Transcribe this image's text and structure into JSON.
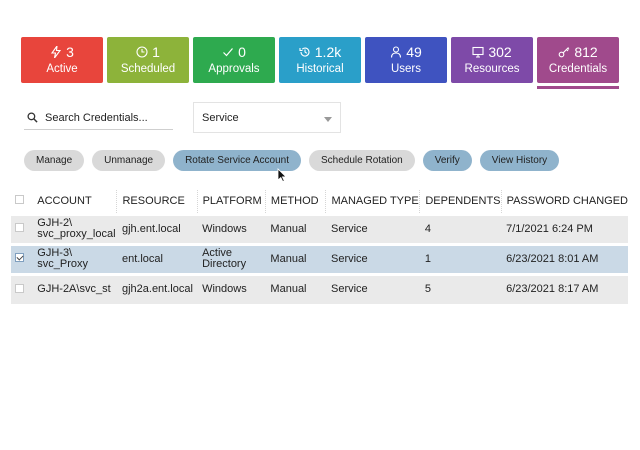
{
  "colors": {
    "active": "#e8453c",
    "scheduled": "#8db33a",
    "approvals": "#2eaa4f",
    "historical": "#2a9fc9",
    "users": "#3f53c0",
    "resources": "#7e4aa8",
    "credentials": "#a04a8c",
    "action_gray": "#d9d9d9",
    "action_blue": "#8fb3cc",
    "row_selected": "#cad9e6"
  },
  "tiles": [
    {
      "icon": "lightning-icon",
      "count": "3",
      "label": "Active"
    },
    {
      "icon": "clock-icon",
      "count": "1",
      "label": "Scheduled"
    },
    {
      "icon": "check-icon",
      "count": "0",
      "label": "Approvals"
    },
    {
      "icon": "history-icon",
      "count": "1.2k",
      "label": "Historical"
    },
    {
      "icon": "user-icon",
      "count": "49",
      "label": "Users"
    },
    {
      "icon": "monitor-icon",
      "count": "302",
      "label": "Resources"
    },
    {
      "icon": "key-icon",
      "count": "812",
      "label": "Credentials"
    }
  ],
  "search": {
    "placeholder": "Search Credentials..."
  },
  "filter": {
    "selected": "Service"
  },
  "actions": [
    "Manage",
    "Unmanage",
    "Rotate Service Account",
    "Schedule Rotation",
    "Verify",
    "View History"
  ],
  "table": {
    "headers": [
      "ACCOUNT",
      "RESOURCE",
      "PLATFORM",
      "METHOD",
      "MANAGED TYPE",
      "DEPENDENTS",
      "PASSWORD CHANGED"
    ],
    "rows": [
      {
        "account": "GJH-2\\ svc_proxy_local",
        "resource": "gjh.ent.local",
        "platform": "Windows",
        "method": "Manual",
        "type": "Service",
        "dependents": "4",
        "changed": "7/1/2021 6:24 PM"
      },
      {
        "account": "GJH-3\\ svc_Proxy",
        "resource": "ent.local",
        "platform": "Active Directory",
        "method": "Manual",
        "type": "Service",
        "dependents": "1",
        "changed": "6/23/2021 8:01 AM"
      },
      {
        "account": "GJH-2A\\svc_st",
        "resource": "gjh2a.ent.local",
        "platform": "Windows",
        "method": "Manual",
        "type": "Service",
        "dependents": "5",
        "changed": "6/23/2021 8:17 AM"
      }
    ]
  }
}
